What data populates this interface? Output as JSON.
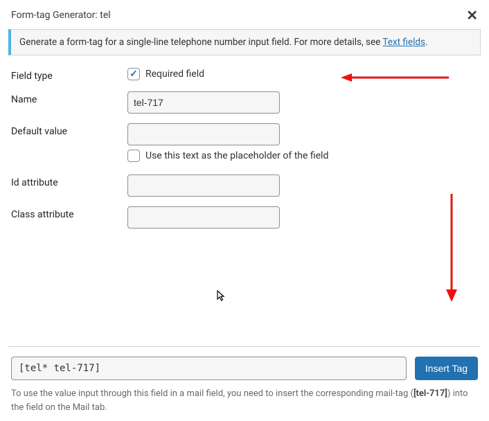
{
  "titlebar": {
    "title": "Form-tag Generator: tel",
    "close_label": "✕"
  },
  "instruction": {
    "text_before": "Generate a form-tag for a single-line telephone number input field. For more details, see ",
    "link_text": "Text fields",
    "text_after": "."
  },
  "form": {
    "field_type_label": "Field type",
    "required_label": "Required field",
    "name_label": "Name",
    "name_value": "tel-717",
    "default_label": "Default value",
    "default_value": "",
    "placeholder_label": "Use this text as the placeholder of the field",
    "id_label": "Id attribute",
    "id_value": "",
    "class_label": "Class attribute",
    "class_value": ""
  },
  "footer": {
    "code_value": "[tel* tel-717]",
    "insert_label": "Insert Tag",
    "note_before": "To use the value input through this field in a mail field, you need to insert the corresponding mail-tag (",
    "note_code": "[tel-717]",
    "note_after": ") into the field on the Mail tab."
  }
}
